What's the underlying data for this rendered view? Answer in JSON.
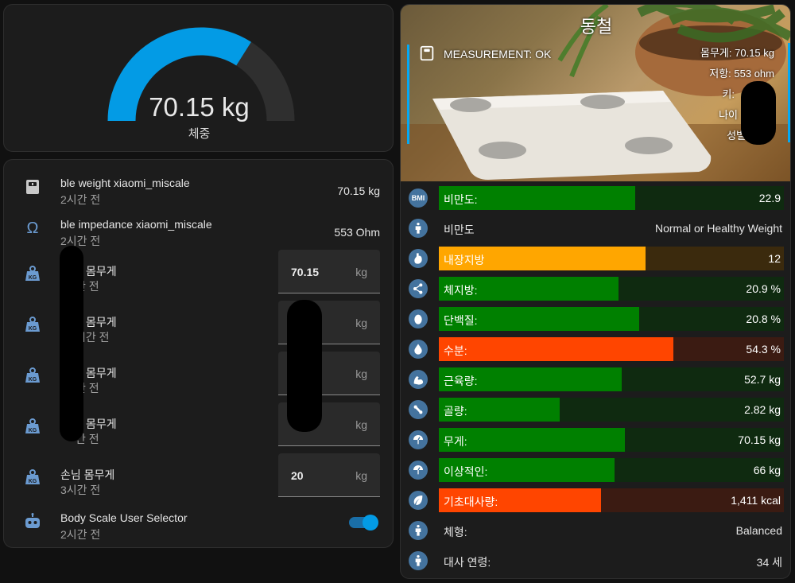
{
  "gauge": {
    "value": "70.15 kg",
    "label": "체중",
    "fill_fraction": 0.68,
    "colors": {
      "fill": "#039be5",
      "track": "#2f2f2f"
    }
  },
  "entities": [
    {
      "icon": "scale-bathroom-icon",
      "name": "ble weight xiaomi_miscale",
      "sub": "2시간 전",
      "state": "70.15 kg"
    },
    {
      "icon": "omega-icon",
      "name": "ble impedance xiaomi_miscale",
      "sub": "2시간 전",
      "state": "553 Ohm"
    },
    {
      "icon": "weight-kg-icon",
      "name": "몸무게",
      "sub": "간 전",
      "input_value": "70.15",
      "unit": "kg"
    },
    {
      "icon": "weight-kg-icon",
      "name": "몸무게",
      "sub": "시간 전",
      "input_value": "",
      "unit": "kg"
    },
    {
      "icon": "weight-kg-icon",
      "name": "몸무게",
      "sub": "간 전",
      "input_value": "",
      "unit": "kg"
    },
    {
      "icon": "weight-kg-icon",
      "name": "몸무게",
      "sub": "간 전",
      "input_value": "",
      "unit": "kg"
    },
    {
      "icon": "weight-kg-icon",
      "name": "손님 몸무게",
      "sub": "3시간 전",
      "input_value": "20",
      "unit": "kg"
    },
    {
      "icon": "robot-icon",
      "name": "Body Scale User Selector",
      "sub": "2시간 전",
      "toggle_on": true
    }
  ],
  "profile": {
    "title": "동철",
    "measurement": "MEASUREMENT: OK",
    "attributes": [
      "몸무게: 70.15 kg",
      "저항: 553 ohm",
      "키:",
      "나이",
      "성별"
    ]
  },
  "metrics": [
    {
      "icon": "bmi-icon",
      "icon_text": "BMI",
      "label": "비만도:",
      "value": "22.9",
      "level": 0.57,
      "color": "#008000",
      "track": "#0f2a10"
    },
    {
      "icon": "human-icon",
      "label": "비만도",
      "value": "Normal or Healthy Weight"
    },
    {
      "icon": "stomach-icon",
      "label": "내장지방",
      "value": "12",
      "level": 0.6,
      "color": "#ffa600",
      "track": "#3b2a0d"
    },
    {
      "icon": "molecule-icon",
      "label": "체지방:",
      "value": "20.9 %",
      "level": 0.52,
      "color": "#008000",
      "track": "#0f2a10"
    },
    {
      "icon": "egg-icon",
      "label": "단백질:",
      "value": "20.8 %",
      "level": 0.58,
      "color": "#008000",
      "track": "#0f2a10"
    },
    {
      "icon": "water-icon",
      "label": "수분:",
      "value": "54.3 %",
      "level": 0.68,
      "color": "#ff4500",
      "track": "#3b1b12"
    },
    {
      "icon": "arm-flex-icon",
      "label": "근육량:",
      "value": "52.7 kg",
      "level": 0.53,
      "color": "#008000",
      "track": "#0f2a10"
    },
    {
      "icon": "bone-icon",
      "label": "골량:",
      "value": "2.82 kg",
      "level": 0.35,
      "color": "#008000",
      "track": "#0f2a10"
    },
    {
      "icon": "scale-icon",
      "label": "무게:",
      "value": "70.15 kg",
      "level": 0.54,
      "color": "#008000",
      "track": "#0f2a10"
    },
    {
      "icon": "scale-icon",
      "label": "이상적인:",
      "value": "66 kg",
      "level": 0.51,
      "color": "#008000",
      "track": "#0f2a10"
    },
    {
      "icon": "leaf-icon",
      "label": "기초대사량:",
      "value": "1,411 kcal",
      "level": 0.47,
      "color": "#ff4500",
      "track": "#3b1b12"
    },
    {
      "icon": "human-icon",
      "label": "체형:",
      "value": "Balanced"
    },
    {
      "icon": "human-icon",
      "label": "대사 연령:",
      "value": "34 세"
    }
  ]
}
